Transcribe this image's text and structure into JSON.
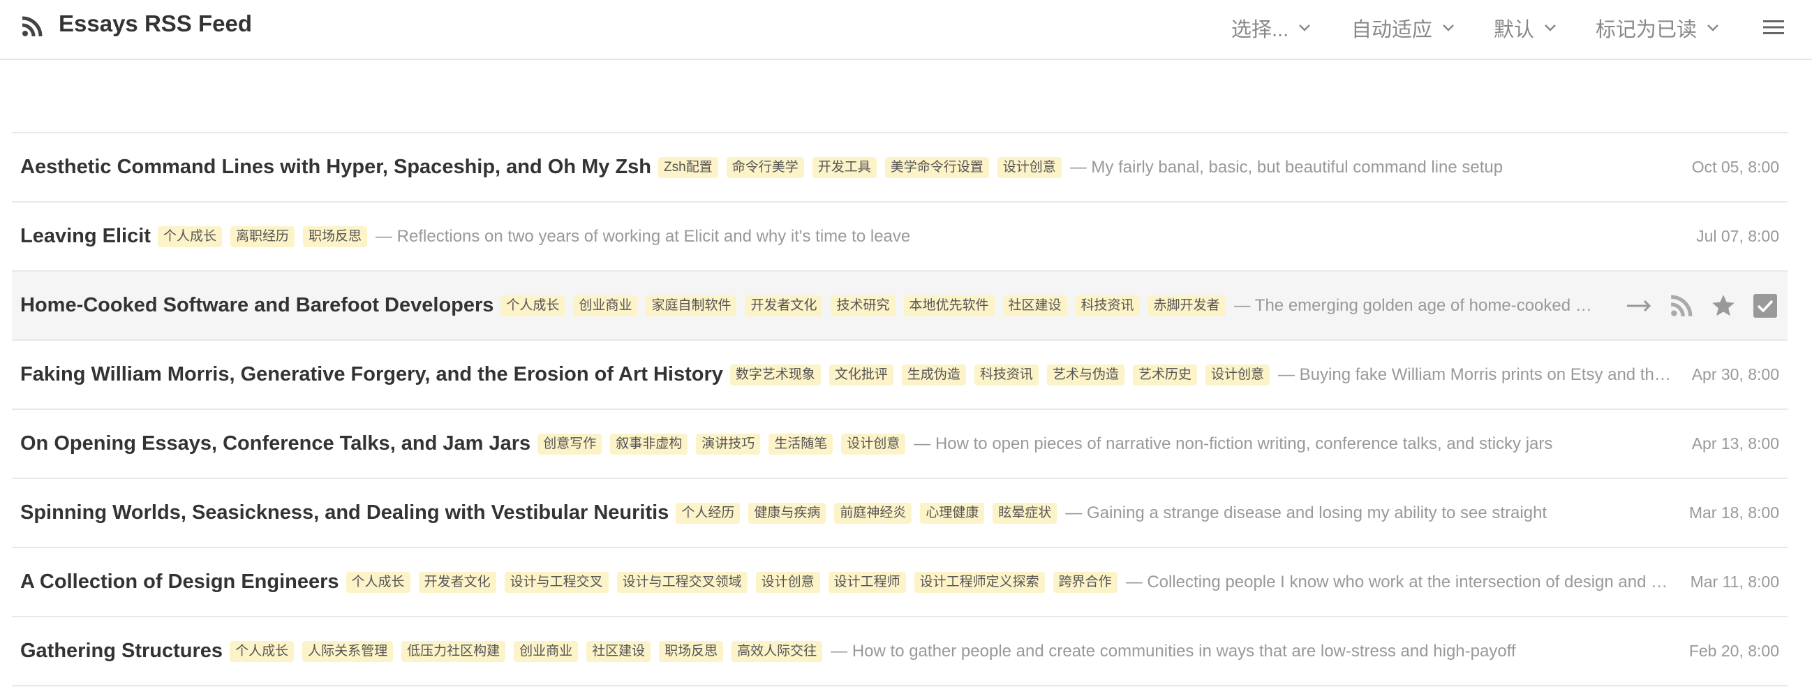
{
  "header": {
    "title": "Essays RSS Feed",
    "controls": {
      "select": "选择...",
      "fit": "自动适应",
      "sort": "默认",
      "mark_read": "标记为已读"
    },
    "icons": {
      "feed": "rss-icon",
      "menu": "hamburger-menu-icon"
    }
  },
  "colors": {
    "tag_bg": "#fdf3c8",
    "hover_row_bg": "#f5f5f5",
    "muted_text": "#999999",
    "title_text": "#333333"
  },
  "items": [
    {
      "title": "Aesthetic Command Lines with Hyper, Spaceship, and Oh My Zsh",
      "tags": [
        "Zsh配置",
        "命令行美学",
        "开发工具",
        "美学命令行设置",
        "设计创意"
      ],
      "desc": "— My fairly banal, basic, but beautiful command line setup",
      "date": "Oct 05, 8:00"
    },
    {
      "title": "Leaving Elicit",
      "tags": [
        "个人成长",
        "离职经历",
        "职场反思"
      ],
      "desc": "— Reflections on two years of working at Elicit and why it's time to leave",
      "date": "Jul 07, 8:00"
    },
    {
      "title": "Home-Cooked Software and Barefoot Developers",
      "tags": [
        "个人成长",
        "创业商业",
        "家庭自制软件",
        "开发者文化",
        "技术研究",
        "本地优先软件",
        "社区建设",
        "科技资讯",
        "赤脚开发者"
      ],
      "desc": "— The emerging golden age of home-cooked software, barefoot developers, and why the local-first community should help build it",
      "date": "",
      "hover": true,
      "actions": [
        "arrow-right-icon",
        "rss-icon",
        "star-icon",
        "checkbox-checked-icon"
      ]
    },
    {
      "title": "Faking William Morris, Generative Forgery, and the Erosion of Art History",
      "tags": [
        "数字艺术现象",
        "文化批评",
        "生成伪造",
        "科技资讯",
        "艺术与伪造",
        "艺术历史",
        "设计创意"
      ],
      "desc": "— Buying fake William Morris prints on Etsy and the slow erosion of art history",
      "date": "Apr 30, 8:00"
    },
    {
      "title": "On Opening Essays, Conference Talks, and Jam Jars",
      "tags": [
        "创意写作",
        "叙事非虚构",
        "演讲技巧",
        "生活随笔",
        "设计创意"
      ],
      "desc": "— How to open pieces of narrative non-fiction writing, conference talks, and sticky jars",
      "date": "Apr 13, 8:00"
    },
    {
      "title": "Spinning Worlds, Seasickness, and Dealing with Vestibular Neuritis",
      "tags": [
        "个人经历",
        "健康与疾病",
        "前庭神经炎",
        "心理健康",
        "眩晕症状"
      ],
      "desc": "— Gaining a strange disease and losing my ability to see straight",
      "date": "Mar 18, 8:00"
    },
    {
      "title": "A Collection of Design Engineers",
      "tags": [
        "个人成长",
        "开发者文化",
        "设计与工程交叉",
        "设计与工程交叉领域",
        "设计创意",
        "设计工程师",
        "设计工程师定义探索",
        "跨界合作"
      ],
      "desc": "— Collecting people I know who work at the intersection of design and engineering",
      "date": "Mar 11, 8:00"
    },
    {
      "title": "Gathering Structures",
      "tags": [
        "个人成长",
        "人际关系管理",
        "低压力社区构建",
        "创业商业",
        "社区建设",
        "职场反思",
        "高效人际交往"
      ],
      "desc": "— How to gather people and create communities in ways that are low-stress and high-payoff",
      "date": "Feb 20, 8:00"
    }
  ]
}
